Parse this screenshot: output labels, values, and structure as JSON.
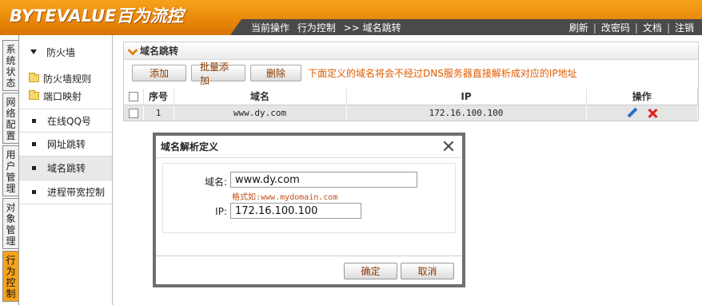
{
  "header": {
    "logo": "BYTEVALUE百为流控",
    "breadcrumb": [
      "当前操作",
      "行为控制",
      ">> 域名跳转"
    ],
    "links": [
      "刷新",
      "改密码",
      "文档",
      "注销"
    ]
  },
  "vtabs": [
    "系统状态",
    "网络配置",
    "用户管理",
    "对象管理",
    "行为控制"
  ],
  "sidebar": {
    "group": "防火墙",
    "subitems": [
      "防火墙规则",
      "端口映射"
    ],
    "items": [
      "在线QQ号",
      "网址跳转",
      "域名跳转",
      "进程带宽控制"
    ]
  },
  "panel": {
    "title": "域名跳转",
    "buttons": [
      "添加",
      "批量添加",
      "删除"
    ],
    "hint": "下面定义的域名将会不经过DNS服务器直接解析成对应的IP地址",
    "columns": [
      "序号",
      "域名",
      "IP",
      "操作"
    ],
    "rows": [
      {
        "index": "1",
        "domain": "www.dy.com",
        "ip": "172.16.100.100"
      }
    ]
  },
  "dialog": {
    "title": "域名解析定义",
    "domain_label": "域名:",
    "domain_value": "www.dy.com",
    "format_hint": "格式如:www.mydomain.com",
    "ip_label": "IP:",
    "ip_value": "172.16.100.100",
    "ok": "确定",
    "cancel": "取消"
  },
  "colors": {
    "header_orange": "#e8860a",
    "nav_dark": "#4a4a4a",
    "hint_orange": "#e05a00",
    "active_tab": "#f7a21b"
  }
}
